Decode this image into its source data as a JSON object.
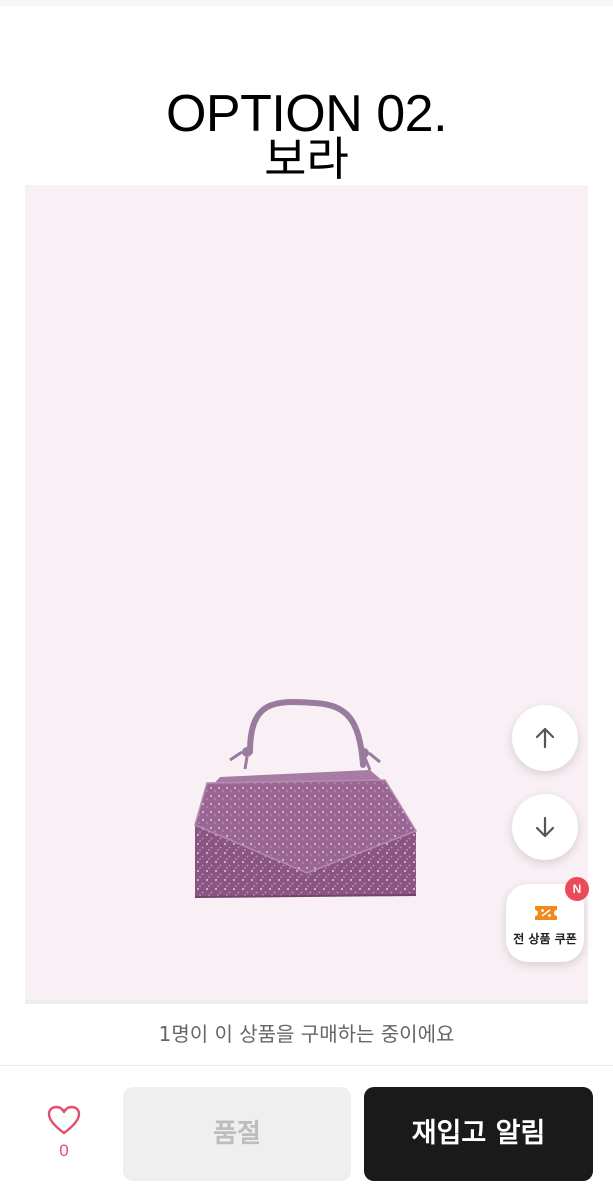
{
  "option_title": {
    "line1": "OPTION 02.",
    "line2": "보라"
  },
  "product_image": {
    "description_icon": "purple-rhinestone-handbag",
    "background_color": "#f8f0f4",
    "bag_color": "#8e5a86"
  },
  "floating_buttons": {
    "scroll_up_icon": "arrow-up-icon",
    "scroll_down_icon": "arrow-down-icon",
    "coupon": {
      "label": "전 상품 쿠폰",
      "badge": "N",
      "icon": "coupon-ticket-icon",
      "icon_color": "#f08a1c",
      "badge_color": "#ea4b5a"
    }
  },
  "social_proof": {
    "text": "1명이 이 상품을 구매하는 중이에요"
  },
  "bottom_bar": {
    "like_count": "0",
    "like_icon": "heart-outline-icon",
    "like_color": "#e0506b",
    "soldout_label": "품절",
    "restock_label": "재입고 알림",
    "restock_bg": "#1a1a1a"
  }
}
